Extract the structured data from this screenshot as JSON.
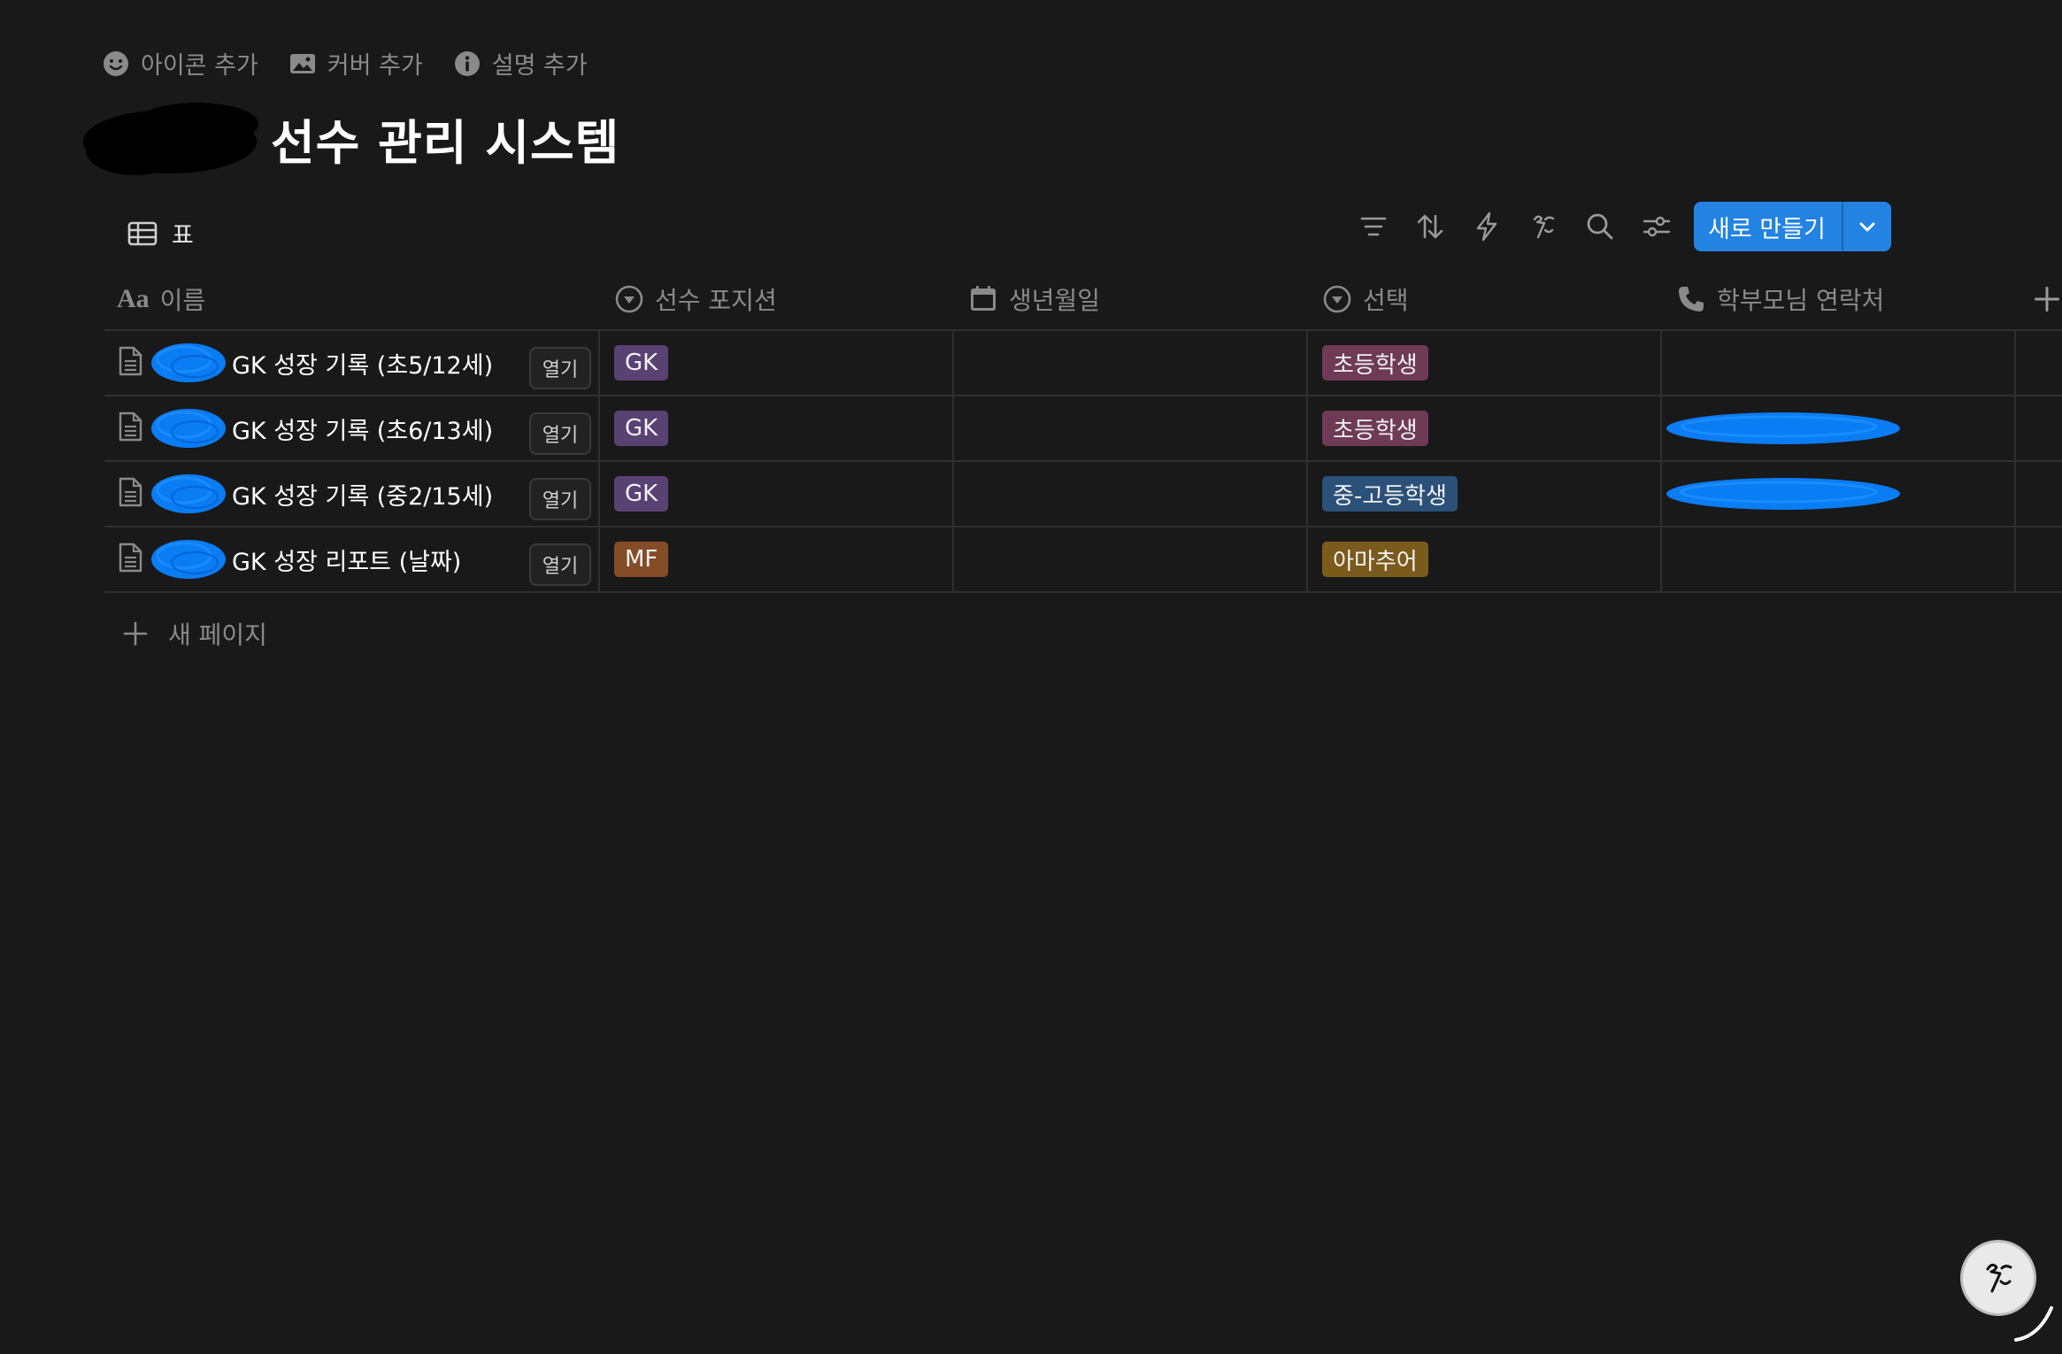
{
  "page_actions": [
    {
      "label": "아이콘 추가",
      "icon": "smiley-icon"
    },
    {
      "label": "커버 추가",
      "icon": "image-icon"
    },
    {
      "label": "설명 추가",
      "icon": "info-icon"
    }
  ],
  "title": "선수 관리 시스템",
  "view": {
    "label": "표",
    "icon": "table-icon"
  },
  "toolbar": {
    "icons": [
      "filter-icon",
      "sort-icon",
      "automation-icon",
      "ai-icon",
      "search-icon",
      "settings-icon"
    ],
    "new_label": "새로 만들기"
  },
  "table": {
    "columns": [
      {
        "label": "이름",
        "icon": "Aa"
      },
      {
        "label": "선수 포지션",
        "icon": "select-icon"
      },
      {
        "label": "생년월일",
        "icon": "calendar-icon"
      },
      {
        "label": "선택",
        "icon": "select-icon"
      },
      {
        "label": "학부모님 연락처",
        "icon": "phone-icon"
      }
    ],
    "rows": [
      {
        "name": "GK 성장 기록 (초5/12세)",
        "open": "열기",
        "position": "GK",
        "position_color": "#5a4174",
        "birth": "",
        "select": "초등학생",
        "select_color": "#6e3a55"
      },
      {
        "name": "GK 성장 기록 (초6/13세)",
        "open": "열기",
        "position": "GK",
        "position_color": "#5a4174",
        "birth": "",
        "select": "초등학생",
        "select_color": "#6e3a55"
      },
      {
        "name": "GK 성장 기록 (중2/15세)",
        "open": "열기",
        "position": "GK",
        "position_color": "#5a4174",
        "birth": "",
        "select": "중-고등학생",
        "select_color": "#2c5178"
      },
      {
        "name": "GK 성장 리포트 (날짜)",
        "open": "열기",
        "position": "MF",
        "position_color": "#854c28",
        "birth": "",
        "select": "아마추어",
        "select_color": "#7a5b1c"
      }
    ]
  },
  "new_page_label": "새 페이지",
  "colors": {
    "background": "#191919",
    "accent": "#2383e2",
    "redaction": "#0a7cf4"
  }
}
